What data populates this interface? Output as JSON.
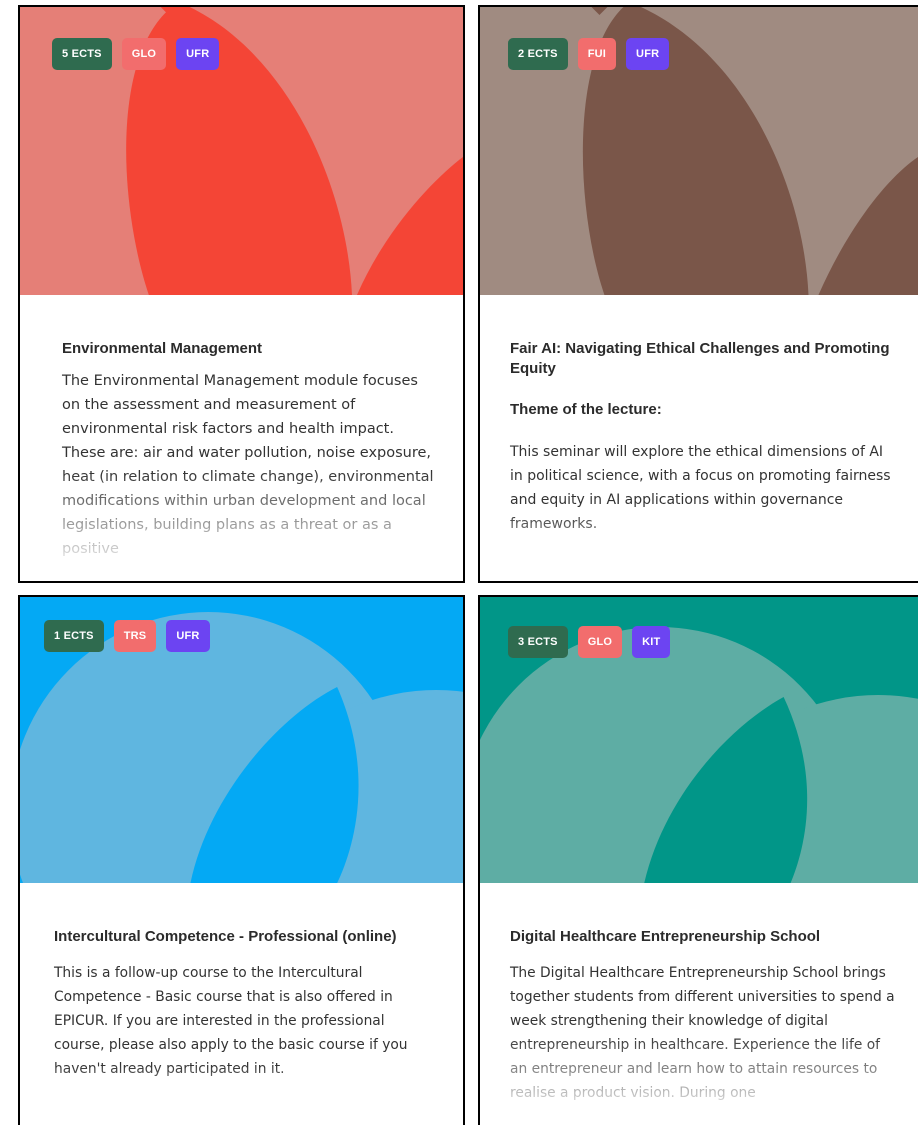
{
  "cards": [
    {
      "badges": {
        "ects": "5 ECTS",
        "tag1": "GLO",
        "tag2": "UFR"
      },
      "title": "Environmental Management",
      "description": "The Environmental Management module focuses on the assessment and measurement of environmental risk factors and health impact. These are: air and water pollution, noise exposure, heat (in relation to climate change), environmental modifications within urban development and local legislations, building plans as a threat or as a positive"
    },
    {
      "badges": {
        "ects": "2 ECTS",
        "tag1": "FUI",
        "tag2": "UFR"
      },
      "title": "Fair AI: Navigating Ethical Challenges and Promoting Equity",
      "subtitle": "Theme of the lecture:",
      "description": "This seminar will explore the ethical dimensions of AI in political science, with a focus on promoting fairness and equity in AI applications within governance frameworks."
    },
    {
      "badges": {
        "ects": "1 ECTS",
        "tag1": "TRS",
        "tag2": "UFR"
      },
      "title": "Intercultural Competence - Professional (online)",
      "description": "This is a follow-up course to the Intercultural Competence - Basic course that is also offered in EPICUR. If you are interested in the professional course, please also apply to the basic course if you haven't already participated in it."
    },
    {
      "badges": {
        "ects": "3 ECTS",
        "tag1": "GLO",
        "tag2": "KIT"
      },
      "title": "Digital Healthcare Entrepreneurship School",
      "description": "The Digital Healthcare Entrepreneurship School brings together students from different universities to spend a week strengthening their knowledge of digital entrepreneurship in healthcare. Experience the life of an entrepreneur and learn how to attain resources to realise a product vision. During one"
    }
  ],
  "colors": {
    "ects_badge": "#2f6b4f",
    "tag1_badge": "#f26d6d",
    "tag2_badge": "#6c44f2",
    "card1_bg": "#e57f77",
    "card1_shape": "#f44536",
    "card2_bg": "#a08b81",
    "card2_shape": "#7a5649",
    "card3_bg": "#04a9f4",
    "card3_shape": "#5fb6e0",
    "card4_bg": "#019688",
    "card4_shape": "#5eada4"
  }
}
